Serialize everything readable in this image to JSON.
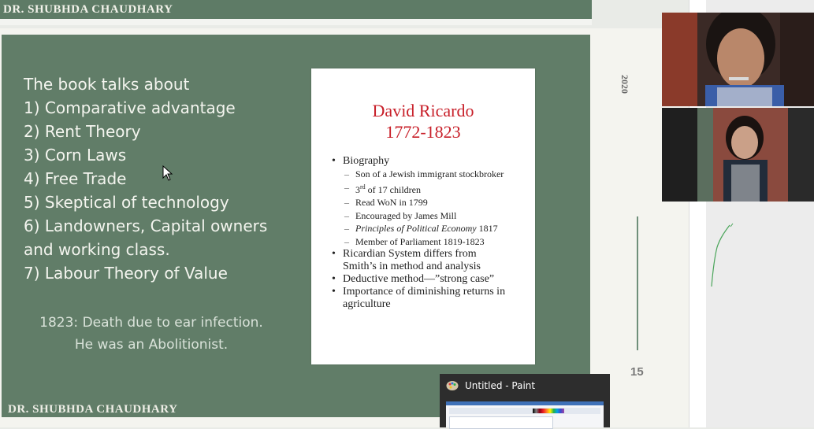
{
  "slide": {
    "author_top": "DR. SHUBHDA CHAUDHARY",
    "author_bottom": "DR. SHUBHDA CHAUDHARY",
    "bullets": [
      "The book talks about",
      "1) Comparative advantage",
      "2) Rent Theory",
      "3) Corn Laws",
      "4) Free Trade",
      "5) Skeptical of technology",
      "6) Landowners, Capital owners",
      "and working class.",
      "7) Labour Theory of Value"
    ],
    "note_line1": "1823: Death due to ear infection.",
    "note_line2": "He was an Abolitionist.",
    "year": "2020",
    "page_number": "15"
  },
  "card": {
    "title_line1": "David Ricardo",
    "title_line2": "1772-1823",
    "biography": "Biography",
    "bio_items": {
      "stockbroker": "Son of a Jewish immigrant stockbroker",
      "children_prefix": "3",
      "children_sup": "rd",
      "children_suffix": " of 17 children",
      "won": "Read WoN in 1799",
      "mill": "Encouraged by James Mill",
      "principles_title": "Principles of Political Economy",
      "principles_year": " 1817",
      "parliament": "Member of Parliament 1819-1823"
    },
    "point2": "Ricardian System differs from Smith’s in method and analysis",
    "point3": "Deductive method—”strong case”",
    "point4": "Importance of diminishing returns in agriculture"
  },
  "taskbar_popup": {
    "title": "Untitled - Paint",
    "icon": "paint-palette-icon"
  },
  "colors": {
    "slide_green": "#617d68",
    "card_title_red": "#c8202a",
    "popup_bg": "#2d2d2d"
  }
}
